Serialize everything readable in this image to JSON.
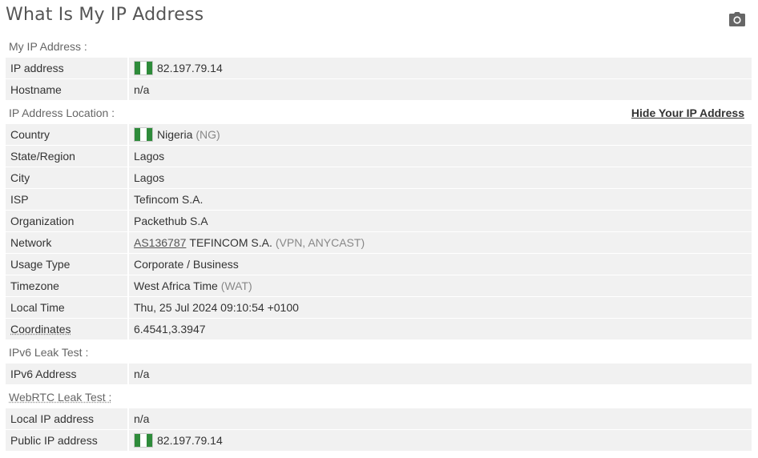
{
  "page": {
    "title": "What Is My IP Address",
    "camera_icon": "camera-icon"
  },
  "my_ip": {
    "heading": "My IP Address :",
    "ip_label": "IP address",
    "ip_value": "82.197.79.14",
    "hostname_label": "Hostname",
    "hostname_value": "n/a"
  },
  "location": {
    "heading": "IP Address Location :",
    "hide_link": "Hide Your IP Address",
    "country_label": "Country",
    "country_value": "Nigeria",
    "country_code": "(NG)",
    "state_label": "State/Region",
    "state_value": "Lagos",
    "city_label": "City",
    "city_value": "Lagos",
    "isp_label": "ISP",
    "isp_value": "Tefincom S.A.",
    "org_label": "Organization",
    "org_value": "Packethub S.A",
    "network_label": "Network",
    "network_asn": "AS136787",
    "network_name": "TEFINCOM S.A.",
    "network_type": "(VPN, ANYCAST)",
    "usage_label": "Usage Type",
    "usage_value": "Corporate / Business",
    "timezone_label": "Timezone",
    "timezone_value": "West Africa Time",
    "timezone_abbr": "(WAT)",
    "localtime_label": "Local Time",
    "localtime_value": "Thu, 25 Jul 2024 09:10:54 +0100",
    "coords_label": "Coordinates",
    "coords_value": "6.4541,3.3947"
  },
  "ipv6": {
    "heading": "IPv6 Leak Test :",
    "address_label": "IPv6 Address",
    "address_value": "n/a"
  },
  "webrtc": {
    "heading": "WebRTC Leak Test :",
    "local_label": "Local IP address",
    "local_value": "n/a",
    "public_label": "Public IP address",
    "public_value": "82.197.79.14"
  },
  "colors": {
    "row_bg": "#f1f1f1",
    "flag_green": "#2e8b3a",
    "muted_text": "#888888"
  }
}
